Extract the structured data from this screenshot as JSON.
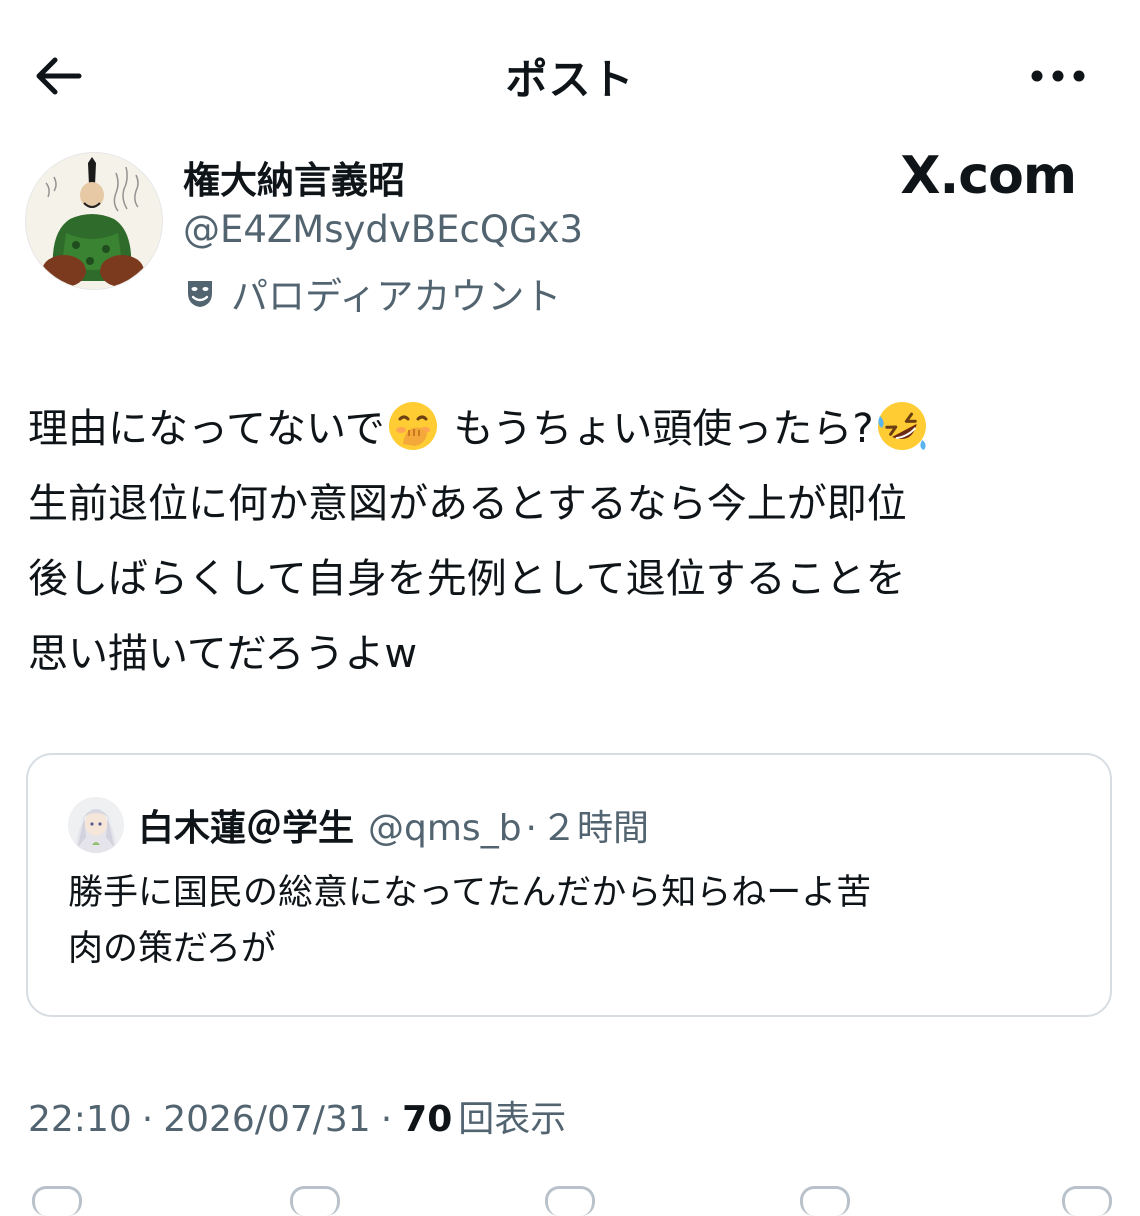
{
  "header": {
    "title": "ポスト",
    "back_icon": "arrow-left-icon",
    "more_icon": "more-horizontal-icon"
  },
  "author": {
    "display_name": "権大納言義昭",
    "handle": "@E4ZMsydvBEcQGx3",
    "parody_label": "パロディアカウント",
    "parody_icon": "theater-mask-icon"
  },
  "watermark": "X.com",
  "tweet": {
    "line1_a": "理由になってないで",
    "line1_b": " もうちょい頭使ったら?",
    "line2": "生前退位に何か意図があるとするなら今上が即位",
    "line3": "後しばらくして自身を先例として退位することを",
    "line4": "思い描いてだろうよw",
    "emoji1": "face-with-hand-over-mouth",
    "emoji2": "rolling-on-the-floor-laughing"
  },
  "quote": {
    "name": "白木蓮＠学生",
    "handle": "@qms_b",
    "separator": "·",
    "time": "２時間",
    "line1": "勝手に国民の総意になってたんだから知らねーよ苦",
    "line2": "肉の策だろが"
  },
  "meta": {
    "time": "22:10",
    "dot1": "·",
    "date": "2026/07/31",
    "dot2": "·",
    "views_count": "70",
    "views_label": "回表示"
  },
  "colors": {
    "text_primary": "#0f1419",
    "text_secondary": "#536471",
    "border": "#d7dde2"
  }
}
